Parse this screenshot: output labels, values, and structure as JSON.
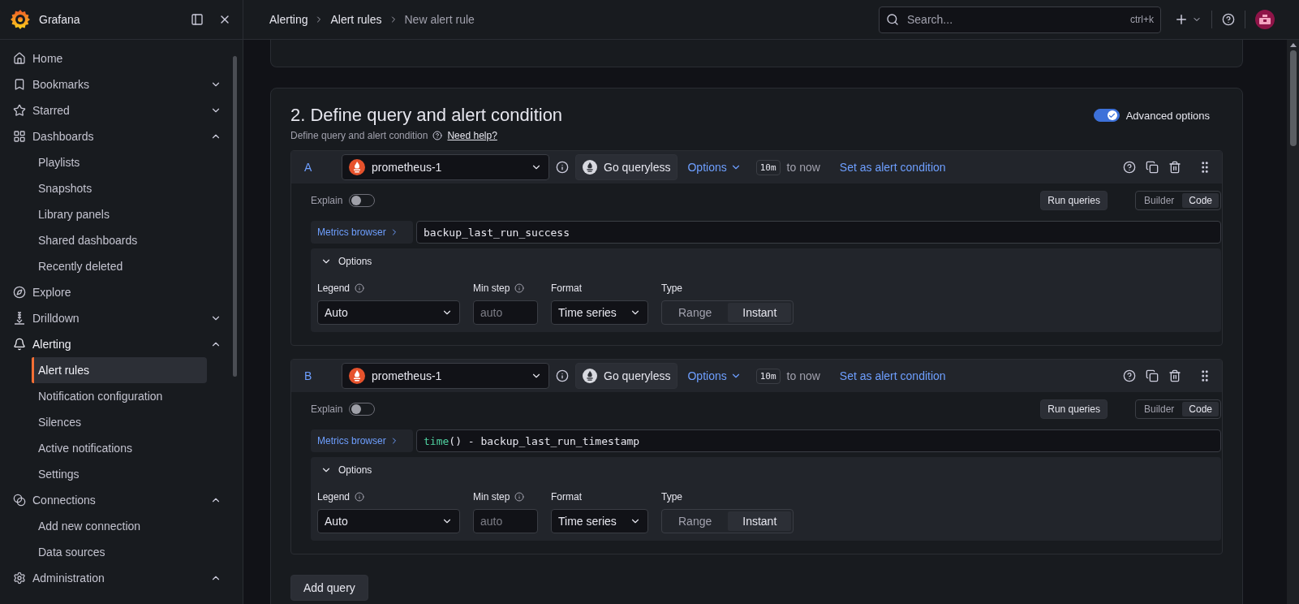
{
  "sidebar": {
    "brand": "Grafana",
    "items": [
      {
        "label": "Home",
        "selected": false
      },
      {
        "label": "Bookmarks",
        "selected": false,
        "expanded": false
      },
      {
        "label": "Starred",
        "selected": false,
        "expanded": false
      },
      {
        "label": "Dashboards",
        "selected": false,
        "expanded": true,
        "children": [
          {
            "label": "Playlists",
            "selected": false
          },
          {
            "label": "Snapshots",
            "selected": false
          },
          {
            "label": "Library panels",
            "selected": false
          },
          {
            "label": "Shared dashboards",
            "selected": false
          },
          {
            "label": "Recently deleted",
            "selected": false
          }
        ]
      },
      {
        "label": "Explore",
        "selected": false
      },
      {
        "label": "Drilldown",
        "selected": false,
        "expanded": false
      },
      {
        "label": "Alerting",
        "selected": false,
        "expanded": true,
        "children": [
          {
            "label": "Alert rules",
            "selected": true
          },
          {
            "label": "Notification configuration",
            "selected": false
          },
          {
            "label": "Silences",
            "selected": false
          },
          {
            "label": "Active notifications",
            "selected": false
          },
          {
            "label": "Settings",
            "selected": false
          }
        ]
      },
      {
        "label": "Connections",
        "selected": false,
        "expanded": true,
        "children": [
          {
            "label": "Add new connection",
            "selected": false
          },
          {
            "label": "Data sources",
            "selected": false
          }
        ]
      },
      {
        "label": "Administration",
        "selected": false,
        "expanded": true
      }
    ]
  },
  "header": {
    "breadcrumbs": [
      "Alerting",
      "Alert rules",
      "New alert rule"
    ],
    "search": {
      "placeholder": "Search...",
      "shortcut": "ctrl+k"
    }
  },
  "section": {
    "title": "2. Define query and alert condition",
    "subtitle": "Define query and alert condition",
    "help_link": "Need help?",
    "advanced_options": {
      "label": "Advanced options",
      "on": true
    }
  },
  "queries": [
    {
      "ref": "A",
      "datasource": "prometheus-1",
      "go_queryless": "Go queryless",
      "options": "Options",
      "time_range": "10m",
      "time_suffix": "to now",
      "set_condition": "Set as alert condition",
      "explain": {
        "label": "Explain",
        "on": false
      },
      "run": "Run queries",
      "modes": [
        {
          "label": "Builder",
          "selected": false
        },
        {
          "label": "Code",
          "selected": true
        }
      ],
      "metrics_browser": "Metrics browser",
      "expression": [
        {
          "text": "backup_last_run_success",
          "kind": "plain"
        }
      ],
      "panel": {
        "title": "Options",
        "expanded": true,
        "legend_label": "Legend",
        "legend": "Auto",
        "min_step_label": "Min step",
        "min_step_placeholder": "auto",
        "format_label": "Format",
        "format": "Time series",
        "type_label": "Type",
        "types": [
          {
            "label": "Range",
            "selected": false
          },
          {
            "label": "Instant",
            "selected": true
          }
        ]
      }
    },
    {
      "ref": "B",
      "datasource": "prometheus-1",
      "go_queryless": "Go queryless",
      "options": "Options",
      "time_range": "10m",
      "time_suffix": "to now",
      "set_condition": "Set as alert condition",
      "explain": {
        "label": "Explain",
        "on": false
      },
      "run": "Run queries",
      "modes": [
        {
          "label": "Builder",
          "selected": false
        },
        {
          "label": "Code",
          "selected": true
        }
      ],
      "metrics_browser": "Metrics browser",
      "expression": [
        {
          "text": "time",
          "kind": "function"
        },
        {
          "text": "() - backup_last_run_timestamp",
          "kind": "plain"
        }
      ],
      "panel": {
        "title": "Options",
        "expanded": true,
        "legend_label": "Legend",
        "legend": "Auto",
        "min_step_label": "Min step",
        "min_step_placeholder": "auto",
        "format_label": "Format",
        "format": "Time series",
        "type_label": "Type",
        "types": [
          {
            "label": "Range",
            "selected": false
          },
          {
            "label": "Instant",
            "selected": true
          }
        ]
      }
    }
  ],
  "add_query": "Add query"
}
